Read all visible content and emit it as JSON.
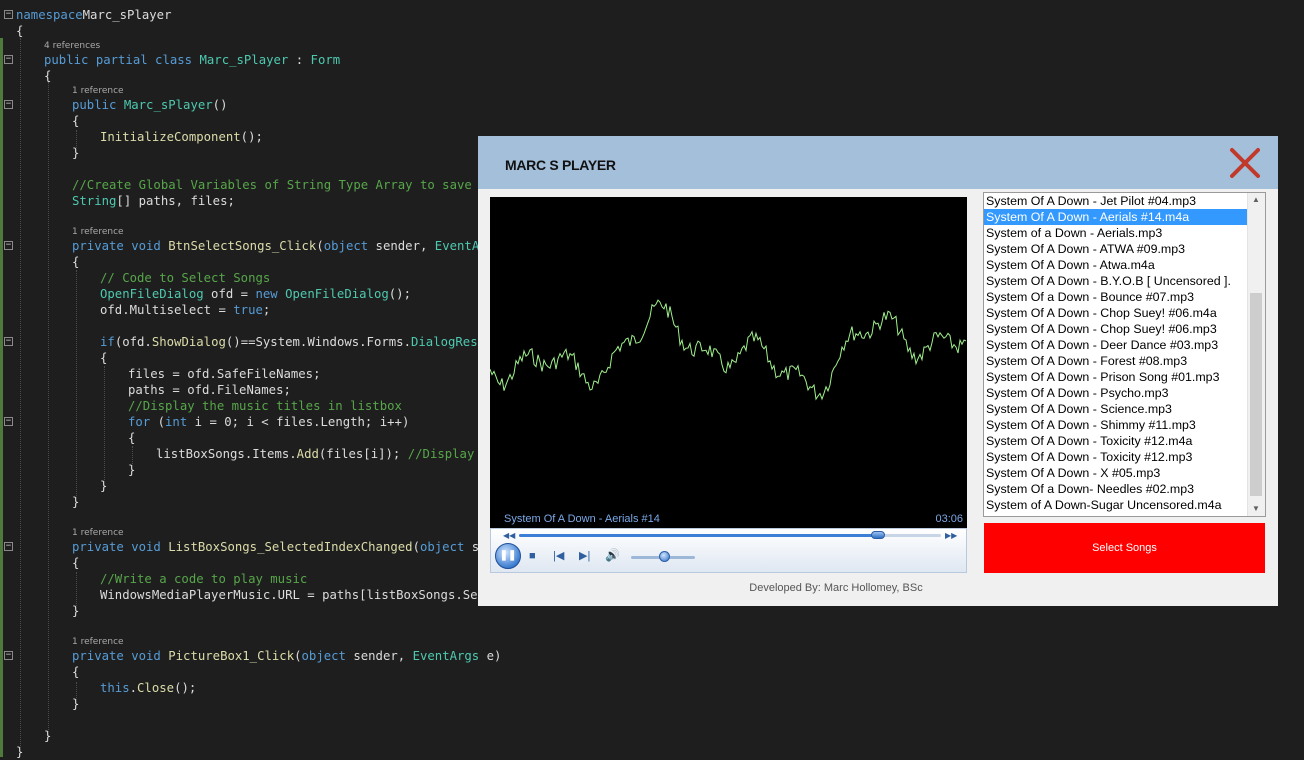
{
  "editor": {
    "lines": [
      [
        [
          "kw",
          "namespace"
        ],
        [
          "",
          "Marc_sPlayer"
        ]
      ],
      [
        [
          "",
          "{"
        ]
      ],
      [
        [
          "kw",
          "public partial class"
        ],
        [
          "",
          " "
        ],
        [
          "ty",
          "Marc_sPlayer"
        ],
        [
          "",
          " : "
        ],
        [
          "ty",
          "Form"
        ]
      ],
      [
        [
          "",
          "{"
        ]
      ],
      [
        [
          "kw",
          "public"
        ],
        [
          "",
          " "
        ],
        [
          "ty",
          "Marc_sPlayer"
        ],
        [
          "",
          "()"
        ]
      ],
      [
        [
          "",
          "{"
        ]
      ],
      [
        [
          "fn",
          "InitializeComponent"
        ],
        [
          "",
          "();"
        ]
      ],
      [
        [
          "",
          "}"
        ]
      ],
      [
        [
          "cm",
          "//Create Global Variables of String Type Array to save the"
        ]
      ],
      [
        [
          "ty",
          "String"
        ],
        [
          "",
          "[] paths, files;"
        ]
      ],
      [
        [
          "kw",
          "private void"
        ],
        [
          "",
          " "
        ],
        [
          "fn",
          "BtnSelectSongs_Click"
        ],
        [
          "",
          "("
        ],
        [
          "kw",
          "object"
        ],
        [
          "",
          " sender, "
        ],
        [
          "ty",
          "EventArgs"
        ]
      ],
      [
        [
          "",
          "{"
        ]
      ],
      [
        [
          "cm",
          "// Code to Select Songs"
        ]
      ],
      [
        [
          "ty",
          "OpenFileDialog"
        ],
        [
          "",
          " ofd = "
        ],
        [
          "kw",
          "new"
        ],
        [
          "",
          " "
        ],
        [
          "ty",
          "OpenFileDialog"
        ],
        [
          "",
          "();"
        ]
      ],
      [
        [
          "",
          "ofd.Multiselect = "
        ],
        [
          "kw",
          "true"
        ],
        [
          "",
          ";"
        ]
      ],
      [
        [
          "kw",
          "if"
        ],
        [
          "",
          "(ofd."
        ],
        [
          "fn",
          "ShowDialog"
        ],
        [
          "",
          "()==System.Windows.Forms."
        ],
        [
          "ty",
          "DialogResult"
        ]
      ],
      [
        [
          "",
          "{"
        ]
      ],
      [
        [
          "",
          "files = ofd.SafeFileNames;"
        ]
      ],
      [
        [
          "",
          "paths = ofd.FileNames;"
        ]
      ],
      [
        [
          "cm",
          "//Display the music titles in listbox"
        ]
      ],
      [
        [
          "kw",
          "for"
        ],
        [
          "",
          " ("
        ],
        [
          "kw",
          "int"
        ],
        [
          "",
          " i = 0; i < files.Length; i++)"
        ]
      ],
      [
        [
          "",
          "{"
        ]
      ],
      [
        [
          "",
          "listBoxSongs.Items."
        ],
        [
          "fn",
          "Add"
        ],
        [
          "",
          "(files[i]); "
        ],
        [
          "cm",
          "//Display So"
        ]
      ],
      [
        [
          "",
          "}"
        ]
      ],
      [
        [
          "",
          "}"
        ]
      ],
      [
        [
          "",
          "}"
        ]
      ],
      [
        [
          "kw",
          "private void"
        ],
        [
          "",
          " "
        ],
        [
          "fn",
          "ListBoxSongs_SelectedIndexChanged"
        ],
        [
          "",
          "("
        ],
        [
          "kw",
          "object"
        ],
        [
          "",
          " send"
        ]
      ],
      [
        [
          "",
          "{"
        ]
      ],
      [
        [
          "cm",
          "//Write a code to play music"
        ]
      ],
      [
        [
          "",
          "WindowsMediaPlayerMusic.URL = paths[listBoxSongs.Selec"
        ]
      ],
      [
        [
          "",
          "}"
        ]
      ],
      [
        [
          "kw",
          "private void"
        ],
        [
          "",
          " "
        ],
        [
          "fn",
          "PictureBox1_Click"
        ],
        [
          "",
          "("
        ],
        [
          "kw",
          "object"
        ],
        [
          "",
          " sender, "
        ],
        [
          "ty",
          "EventArgs"
        ],
        [
          "",
          " e)"
        ]
      ],
      [
        [
          "",
          "{"
        ]
      ],
      [
        [
          "kw",
          "this"
        ],
        [
          "",
          "."
        ],
        [
          "fn",
          "Close"
        ],
        [
          "",
          "();"
        ]
      ],
      [
        [
          "",
          "}"
        ]
      ],
      [
        [
          "",
          "}"
        ]
      ],
      [
        [
          "",
          "}"
        ]
      ]
    ],
    "refs": [
      "4 references",
      "1 reference",
      "1 reference",
      "1 reference",
      "1 reference"
    ]
  },
  "player": {
    "title": "MARC S PLAYER",
    "now_playing": "System Of A Down - Aerials #14",
    "duration": "03:06",
    "seek_progress": 0.85,
    "volume_level": 0.5,
    "developer": "Developed By: Marc Hollomey, BSc",
    "select_button": "Select Songs",
    "selected_index": 1,
    "songs": [
      "System Of  A Down - Jet Pilot #04.mp3",
      "System Of A Down - Aerials #14.m4a",
      "System of a Down - Aerials.mp3",
      "System Of A Down - ATWA #09.mp3",
      "System Of A Down - Atwa.m4a",
      "System Of A Down - B.Y.O.B [ Uncensored ].",
      "System Of a Down - Bounce #07.mp3",
      "System Of A Down - Chop Suey! #06.m4a",
      "System Of A Down - Chop Suey! #06.mp3",
      "System Of A Down - Deer Dance #03.mp3",
      "System Of A Down - Forest #08.mp3",
      "System Of A Down - Prison Song #01.mp3",
      "System Of A Down - Psycho.mp3",
      "System Of A Down - Science.mp3",
      "System Of A Down - Shimmy #11.mp3",
      "System Of A Down - Toxicity #12.m4a",
      "System Of A Down - Toxicity #12.mp3",
      "System Of A Down - X #05.mp3",
      "System Of a Down- Needles #02.mp3",
      "System of A Down-Sugar Uncensored.m4a"
    ],
    "colors": {
      "titlebar": "#a3bfd9",
      "close": "#c0392b",
      "select_button": "#ff0000",
      "wave": "#9ef08a"
    }
  }
}
